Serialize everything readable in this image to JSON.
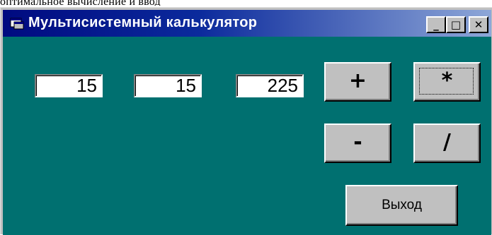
{
  "top_fragment": "оптимальное вычисление и ввод",
  "window": {
    "title": "Мультисистемный калькулятор",
    "caption_buttons": {
      "minimize": "_",
      "maximize": "□",
      "close": "✕"
    }
  },
  "fields": {
    "operand1": "15",
    "operand2": "15",
    "result": "225"
  },
  "buttons": {
    "plus": "+",
    "multiply": "*",
    "minus": "-",
    "divide": "/",
    "exit": "Выход"
  },
  "colors": {
    "client_bg": "#007070",
    "titlebar_start": "#000a80",
    "titlebar_end": "#8ea7d8",
    "face": "#c0c0c0"
  },
  "icons": {
    "app": "window-app-icon"
  }
}
